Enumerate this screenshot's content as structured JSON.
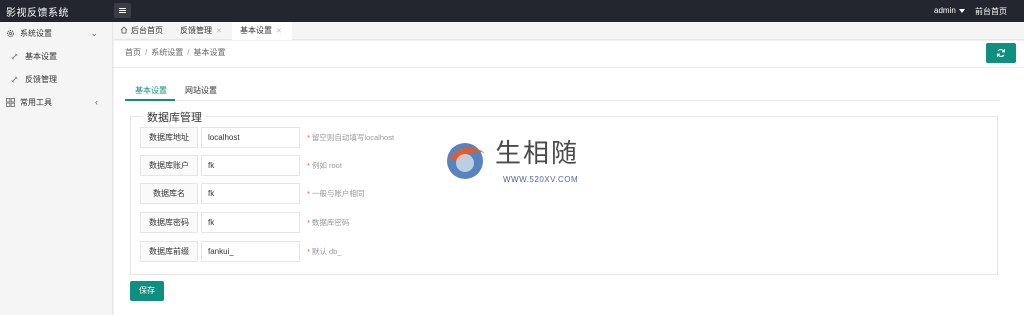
{
  "app": {
    "title": "影视反馈系统",
    "user": "admin",
    "front_link": "前台首页"
  },
  "sidebar": {
    "groups": [
      {
        "label": "系统设置",
        "icon": "gear-icon",
        "expanded": true,
        "items": [
          {
            "label": "基本设置",
            "icon": "link-icon"
          },
          {
            "label": "反馈管理",
            "icon": "link-icon"
          }
        ]
      },
      {
        "label": "常用工具",
        "icon": "grid-icon",
        "expanded": false
      }
    ]
  },
  "tabs": [
    {
      "label": "后台首页",
      "icon": "home-icon",
      "closable": false
    },
    {
      "label": "反馈管理",
      "closable": true
    },
    {
      "label": "基本设置",
      "closable": true,
      "active": true
    }
  ],
  "breadcrumb": [
    "首页",
    "系统设置",
    "基本设置"
  ],
  "settings_tabs": [
    {
      "label": "基本设置",
      "active": true
    },
    {
      "label": "网站设置",
      "active": false
    }
  ],
  "db": {
    "legend": "数据库管理",
    "fields": [
      {
        "label": "数据库地址",
        "value": "localhost",
        "hint": "留空则自动填写localhost"
      },
      {
        "label": "数据库账户",
        "value": "fk",
        "hint": "例如 root"
      },
      {
        "label": "数据库名",
        "value": "fk",
        "hint": "一般与账户相同"
      },
      {
        "label": "数据库密码",
        "value": "fk",
        "hint": "数据库密码"
      },
      {
        "label": "数据库前缀",
        "value": "fankui_",
        "hint": "默认 db_"
      }
    ]
  },
  "save_label": "保存",
  "watermark": {
    "text": "生相随",
    "url": "WWW.520XV.COM"
  },
  "colors": {
    "accent": "#0f8f7f",
    "topbar": "#23262e",
    "hint_star": "#ff5722"
  }
}
